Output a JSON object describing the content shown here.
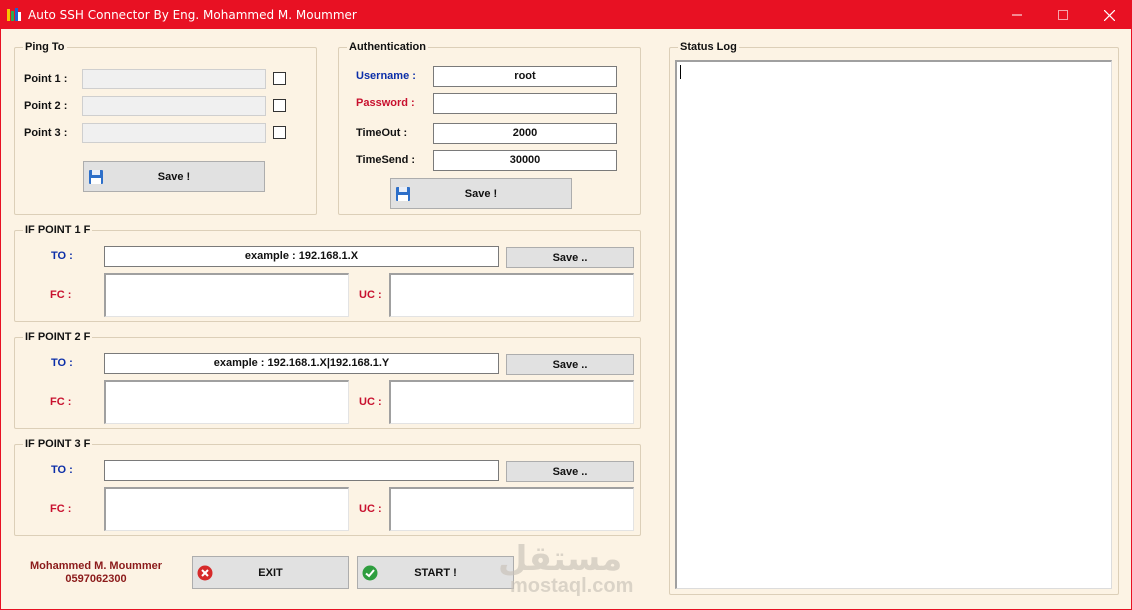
{
  "window": {
    "title": "Auto SSH Connector By Eng. Mohammed M. Moummer",
    "accent_color": "#e81123",
    "background_color": "#fcf3e4"
  },
  "ping_to": {
    "title": "Ping To",
    "points": [
      {
        "label": "Point 1 :",
        "value": "",
        "checked": false
      },
      {
        "label": "Point 2 :",
        "value": "",
        "checked": false
      },
      {
        "label": "Point 3 :",
        "value": "",
        "checked": false
      }
    ],
    "save_label": "Save !"
  },
  "auth": {
    "title": "Authentication",
    "username_label": "Username :",
    "username_value": "root",
    "password_label": "Password :",
    "password_value": "",
    "timeout_label": "TimeOut :",
    "timeout_value": "2000",
    "timesend_label": "TimeSend :",
    "timesend_value": "30000",
    "save_label": "Save !"
  },
  "if_points": [
    {
      "title": "IF POINT 1 F",
      "to_label": "TO :",
      "to_value": "example : 192.168.1.X",
      "fc_label": "FC :",
      "uc_label": "UC :",
      "save_label": "Save .."
    },
    {
      "title": "IF POINT 2 F",
      "to_label": "TO :",
      "to_value": "example : 192.168.1.X|192.168.1.Y",
      "fc_label": "FC :",
      "uc_label": "UC :",
      "save_label": "Save .."
    },
    {
      "title": "IF POINT 3 F",
      "to_label": "TO :",
      "to_value": "",
      "fc_label": "FC :",
      "uc_label": "UC :",
      "save_label": "Save .."
    }
  ],
  "status_log": {
    "title": "Status Log",
    "content": ""
  },
  "footer": {
    "author_name": "Mohammed M. Moummer",
    "author_phone": "0597062300",
    "exit_label": "EXIT",
    "start_label": "START !"
  },
  "watermark": {
    "arabic": "مستقل",
    "latin": "mostaql.com"
  },
  "icons": {
    "app": "app-logo-icon",
    "save": "floppy-disk-icon",
    "exit": "red-x-circle-icon",
    "start": "green-check-circle-icon"
  }
}
